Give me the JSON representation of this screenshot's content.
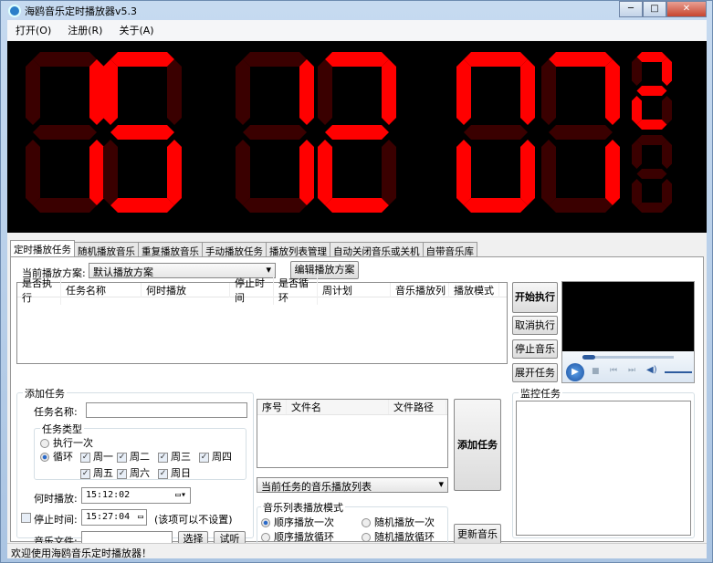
{
  "window": {
    "title": "海鸥音乐定时播放器v5.3",
    "minimize": "─",
    "maximize": "□",
    "close": "✕"
  },
  "menu": [
    "打开(O)",
    "注册(R)",
    "关于(A)"
  ],
  "clock": {
    "digits": [
      "1",
      "5",
      "1",
      "2",
      "0",
      "7"
    ],
    "small_digits": [
      "2",
      ""
    ],
    "lit_color": "#ff0000",
    "dim_color": "#3a0000"
  },
  "tabs": [
    "定时播放任务",
    "随机播放音乐",
    "重复播放音乐",
    "手动播放任务",
    "播放列表管理",
    "自动关闭音乐或关机",
    "自带音乐库"
  ],
  "scheme": {
    "label": "当前播放方案:",
    "value": "默认播放方案",
    "edit_button": "编辑播放方案"
  },
  "task_table": {
    "columns": [
      "是否执行",
      "任务名称",
      "何时播放",
      "停止时间",
      "是否循环",
      "周计划",
      "音乐播放列",
      "播放模式"
    ]
  },
  "side_buttons": {
    "start": "开始执行",
    "cancel": "取消执行",
    "stop": "停止音乐",
    "expand": "展开任务"
  },
  "add_task": {
    "legend": "添加任务",
    "name_label": "任务名称:",
    "name_value": "",
    "type_legend": "任务类型",
    "once": "执行一次",
    "loop": "循环",
    "days": [
      {
        "label": "周一",
        "checked": true
      },
      {
        "label": "周二",
        "checked": true
      },
      {
        "label": "周三",
        "checked": true
      },
      {
        "label": "周四",
        "checked": true
      },
      {
        "label": "周五",
        "checked": true
      },
      {
        "label": "周六",
        "checked": true
      },
      {
        "label": "周日",
        "checked": true
      }
    ],
    "play_time_label": "何时播放:",
    "play_time": "15:12:02",
    "stop_time_label": "停止时间:",
    "stop_time": "15:27:04",
    "stop_note": "(该项可以不设置)",
    "music_label": "音乐文件:",
    "music_value": "",
    "choose": "选择",
    "preview": "试听"
  },
  "file_table": {
    "columns": [
      "序号",
      "文件名",
      "文件路径"
    ]
  },
  "playlist_select": "当前任务的音乐播放列表",
  "add_button": "添加任务",
  "play_mode": {
    "legend": "音乐列表播放模式",
    "options": [
      "顺序播放一次",
      "随机播放一次",
      "顺序播放循环",
      "随机播放循环"
    ],
    "selected": 0
  },
  "update_button": "更新音乐",
  "monitor": {
    "legend": "监控任务"
  },
  "status": "欢迎使用海鸥音乐定时播放器！"
}
